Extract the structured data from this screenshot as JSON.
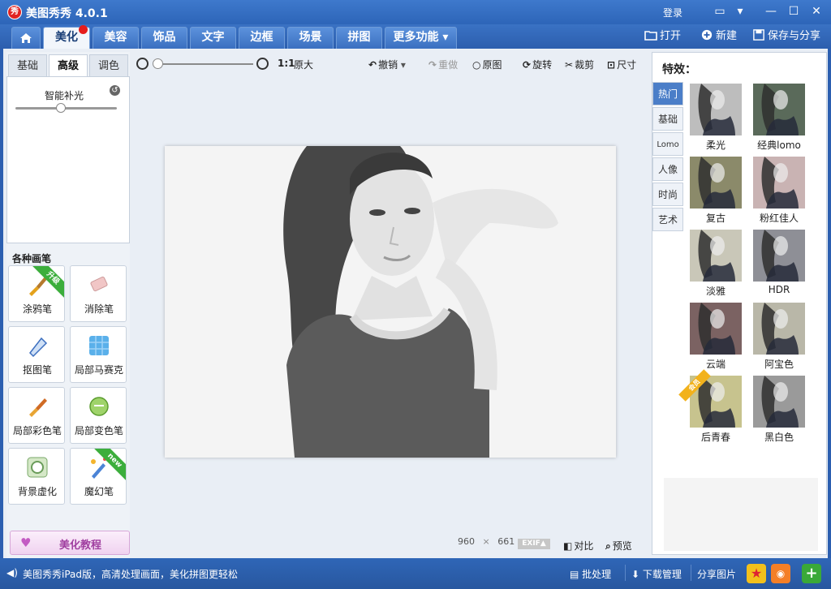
{
  "app": {
    "title": "美图秀秀 4.0.1",
    "logo_text": "秀",
    "login": "登录"
  },
  "window_controls": {
    "min": "—",
    "max": "☐",
    "close": "✕"
  },
  "nav": {
    "tabs": [
      {
        "label": "",
        "icon": "home-icon"
      },
      {
        "label": "美化"
      },
      {
        "label": "美容"
      },
      {
        "label": "饰品"
      },
      {
        "label": "文字"
      },
      {
        "label": "边框"
      },
      {
        "label": "场景"
      },
      {
        "label": "拼图"
      },
      {
        "label": "更多功能 ▾"
      }
    ],
    "actions": {
      "open": "打开",
      "new": "新建",
      "save": "保存与分享"
    }
  },
  "left": {
    "tabs": [
      "基础",
      "高级",
      "调色"
    ],
    "adjust_label": "智能补光",
    "adjust_value": 0.45,
    "brushes_title": "各种画笔",
    "brushes": [
      {
        "label": "涂鸦笔",
        "badge": "升级"
      },
      {
        "label": "消除笔",
        "badge": ""
      },
      {
        "label": "抠图笔",
        "badge": ""
      },
      {
        "label": "局部马赛克",
        "badge": ""
      },
      {
        "label": "局部彩色笔",
        "badge": ""
      },
      {
        "label": "局部变色笔",
        "badge": ""
      },
      {
        "label": "背景虚化",
        "badge": ""
      },
      {
        "label": "魔幻笔",
        "badge": "new"
      }
    ],
    "tutorial": "美化教程"
  },
  "toolbar": {
    "ratio": "1:1",
    "original_size": "原大",
    "undo": "撤销",
    "redo": "重做",
    "original": "原图",
    "rotate": "旋转",
    "crop": "裁剪",
    "size": "尺寸"
  },
  "canvas": {
    "width_px": "960",
    "height_px": "661",
    "times": "×",
    "exif": "EXIF▲",
    "compare": "对比",
    "preview": "预览"
  },
  "effects": {
    "title": "特效：",
    "tabs": [
      "热门",
      "基础",
      "Lomo",
      "人像",
      "时尚",
      "艺术"
    ],
    "items": [
      {
        "label": "柔光",
        "tone": "#bdbdbd"
      },
      {
        "label": "经典lomo",
        "tone": "#5a6a5a"
      },
      {
        "label": "复古",
        "tone": "#8b8a6a"
      },
      {
        "label": "粉红佳人",
        "tone": "#c9b3b3"
      },
      {
        "label": "淡雅",
        "tone": "#c9c7b8"
      },
      {
        "label": "HDR",
        "tone": "#8e8f96"
      },
      {
        "label": "云端",
        "tone": "#7b6262"
      },
      {
        "label": "阿宝色",
        "tone": "#b9b7a8"
      },
      {
        "label": "后青春",
        "tone": "#c7c38e"
      },
      {
        "label": "黑白色",
        "tone": "#9a9a9a"
      }
    ],
    "vip_badge": "会员"
  },
  "bottom": {
    "promo": "美图秀秀iPad版，高清处理画面，美化拼图更轻松",
    "batch": "批处理",
    "downloads": "下载管理",
    "share": "分享图片"
  }
}
